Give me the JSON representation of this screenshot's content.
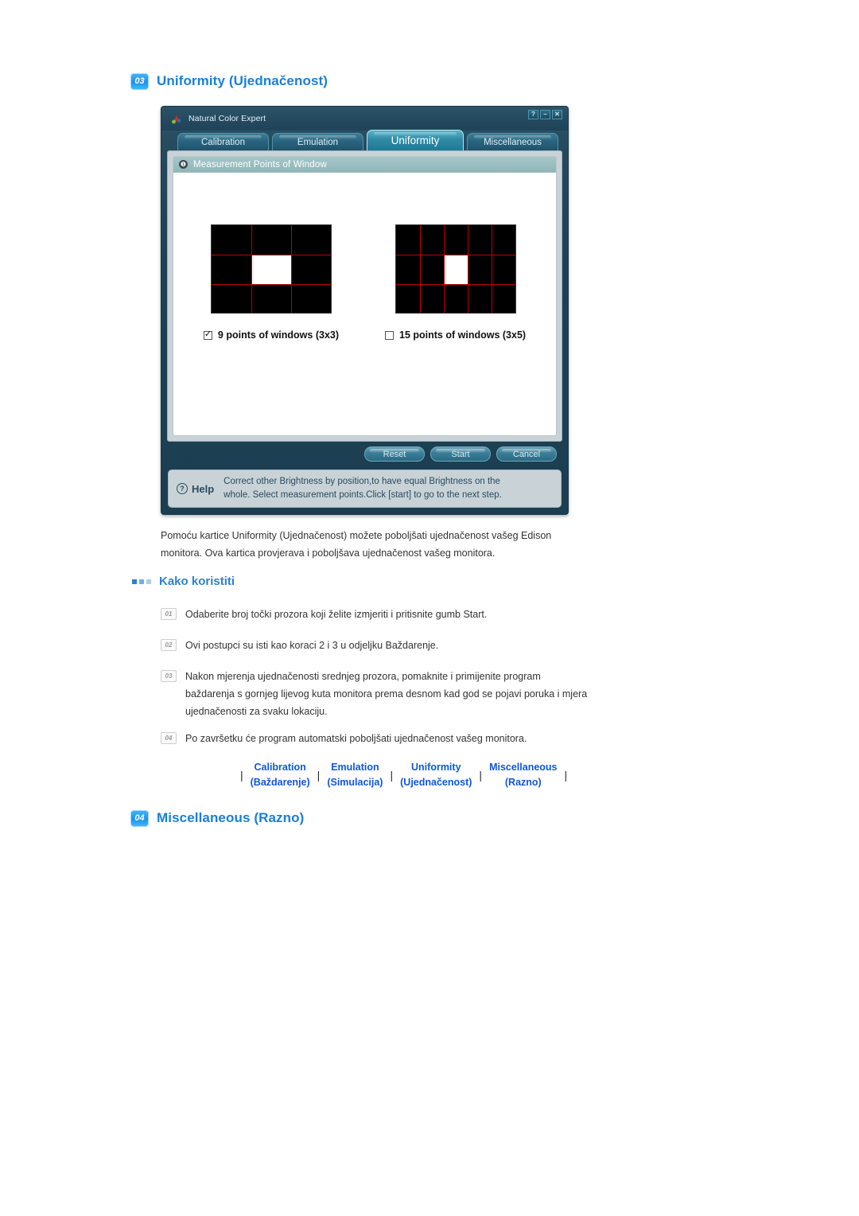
{
  "sections": {
    "uniformity": {
      "num": "03",
      "title": "Uniformity (Ujednačenost)"
    },
    "miscellaneous": {
      "num": "04",
      "title": "Miscellaneous (Razno)"
    }
  },
  "app": {
    "title": "Natural Color Expert",
    "window_controls": {
      "help": "?",
      "minimize": "–",
      "close": "✕"
    },
    "tabs": [
      {
        "label": "Calibration",
        "active": false
      },
      {
        "label": "Emulation",
        "active": false
      },
      {
        "label": "Uniformity",
        "active": true
      },
      {
        "label": "Miscellaneous",
        "active": false
      }
    ],
    "panel": {
      "header": "Measurement Points of Window",
      "header_icon": "info-icon",
      "options": [
        {
          "label": "9 points of windows (3x3)",
          "checked": true,
          "cols": 3,
          "rows": 3
        },
        {
          "label": "15 points of windows (3x5)",
          "checked": false,
          "cols": 5,
          "rows": 3
        }
      ]
    },
    "buttons": [
      {
        "label": "Reset"
      },
      {
        "label": "Start"
      },
      {
        "label": "Cancel"
      }
    ],
    "help": {
      "label": "Help",
      "icon": "question-circle-icon",
      "line1": "Correct other Brightness by position,to have equal Brightness on the",
      "line2": "whole. Select measurement points.Click [start] to go to the next step."
    }
  },
  "intro": {
    "line1": "Pomoću kartice Uniformity (Ujednačenost) možete poboljšati ujednačenost vašeg Edison",
    "line2": "monitora. Ova kartica provjerava i poboljšava ujednačenost vašeg monitora."
  },
  "howto": {
    "title": "Kako koristiti",
    "steps": [
      {
        "num": "01",
        "text": "Odaberite broj točki prozora koji želite izmjeriti i pritisnite gumb Start."
      },
      {
        "num": "02",
        "text": "Ovi postupci su isti kao koraci 2 i 3 u odjeljku Baždarenje."
      },
      {
        "num": "03",
        "text": "Nakon mjerenja ujednačenosti srednjeg prozora, pomaknite i primijenite program baždarenja s gornjeg lijevog kuta monitora prema desnom kad god se pojavi poruka i mjera ujednačenosti za svaku lokaciju."
      },
      {
        "num": "04",
        "text": "Po završetku će program automatski poboljšati ujednačenost vašeg monitora."
      }
    ]
  },
  "navlinks": {
    "separator": "|",
    "items": [
      {
        "en": "Calibration",
        "hr": "(Baždarenje)"
      },
      {
        "en": "Emulation",
        "hr": "(Simulacija)"
      },
      {
        "en": "Uniformity",
        "hr": "(Ujednačenost)"
      },
      {
        "en": "Miscellaneous",
        "hr": "(Razno)"
      }
    ]
  },
  "colors": {
    "accent_blue": "#1b7fd4",
    "link_blue": "#1157d8",
    "sub_blue": "#2f82c9",
    "grid_red": "#c00000",
    "app_bg": "#1d4154"
  }
}
